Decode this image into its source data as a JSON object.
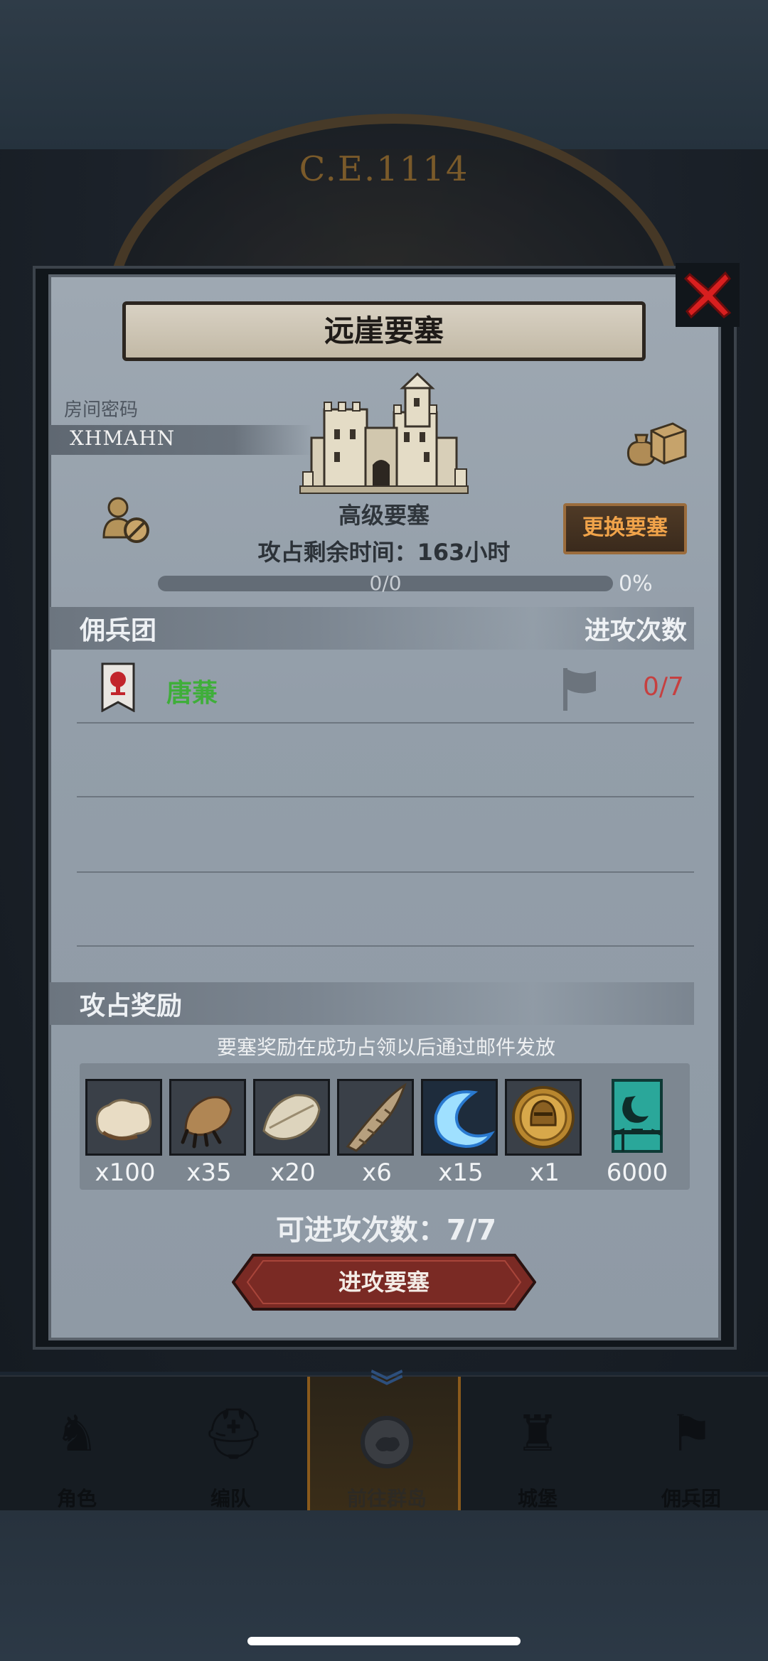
{
  "background": {
    "era_text": "C.E.1114"
  },
  "dialog": {
    "title": "远崖要塞",
    "room": {
      "label": "房间密码",
      "code": "XHMAHN"
    },
    "fortress_grade": "高级要塞",
    "remaining_time": "攻占剩余时间：163小时",
    "change_button": "更换要塞",
    "progress": {
      "text": "0/0",
      "percent_text": "0%",
      "value": 0
    },
    "mercenary_section": {
      "title": "佣兵团",
      "attacks_header": "进攻次数",
      "rows": [
        {
          "name": "唐蒹",
          "attacks": "0/7"
        }
      ]
    },
    "rewards_section": {
      "title": "攻占奖励",
      "note": "要塞奖励在成功占领以后通过邮件发放",
      "items": [
        {
          "icon": "fur-pelt-icon",
          "qty": "x100"
        },
        {
          "icon": "claw-icon",
          "qty": "x35"
        },
        {
          "icon": "feather-pelt-icon",
          "qty": "x20"
        },
        {
          "icon": "horn-icon",
          "qty": "x6"
        },
        {
          "icon": "crescent-moon-icon",
          "qty": "x15"
        },
        {
          "icon": "knight-medal-icon",
          "qty": "x1"
        },
        {
          "icon": "guild-banner-icon",
          "qty": "6000"
        }
      ]
    },
    "attack_count": "可进攻次数：7/7",
    "attack_button": "进攻要塞"
  },
  "nav": {
    "items": [
      {
        "label": "角色",
        "icon": "knight-icon"
      },
      {
        "label": "编队",
        "icon": "helmet-icon"
      },
      {
        "label": "前往群岛",
        "icon": "compass-icon",
        "active": true
      },
      {
        "label": "城堡",
        "icon": "castle-icon"
      },
      {
        "label": "佣兵团",
        "icon": "banner-icon"
      }
    ]
  },
  "colors": {
    "panel": "#939ea9",
    "merc_name": "#3fae3a",
    "attacks_count": "#c64040",
    "change_button_text": "#f0a34a",
    "attack_button": "#7a2a24"
  }
}
